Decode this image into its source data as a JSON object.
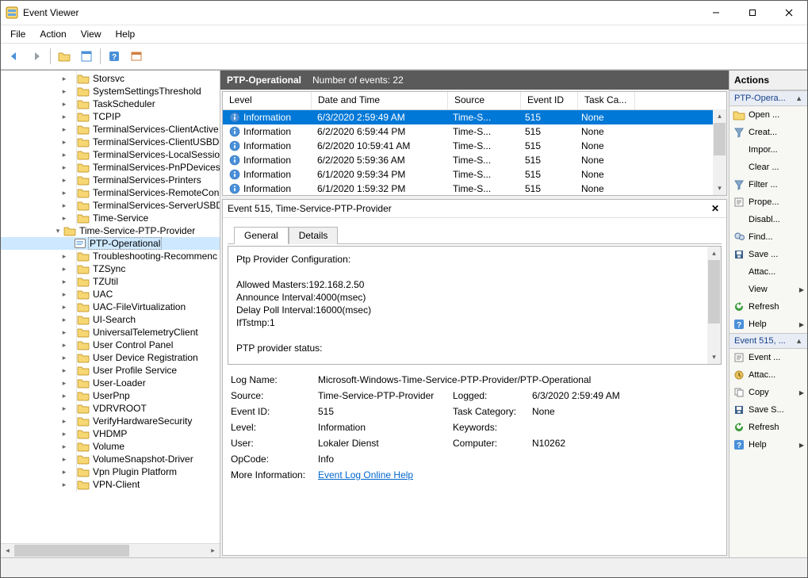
{
  "window": {
    "title": "Event Viewer"
  },
  "menu": {
    "file": "File",
    "action": "Action",
    "view": "View",
    "help": "Help"
  },
  "tree": {
    "items": [
      {
        "indent": 5,
        "tw": "col",
        "icon": "folder",
        "label": "Storsvc"
      },
      {
        "indent": 5,
        "tw": "col",
        "icon": "folder",
        "label": "SystemSettingsThreshold"
      },
      {
        "indent": 5,
        "tw": "col",
        "icon": "folder",
        "label": "TaskScheduler"
      },
      {
        "indent": 5,
        "tw": "col",
        "icon": "folder",
        "label": "TCPIP"
      },
      {
        "indent": 5,
        "tw": "col",
        "icon": "folder",
        "label": "TerminalServices-ClientActive"
      },
      {
        "indent": 5,
        "tw": "col",
        "icon": "folder",
        "label": "TerminalServices-ClientUSBDe"
      },
      {
        "indent": 5,
        "tw": "col",
        "icon": "folder",
        "label": "TerminalServices-LocalSession"
      },
      {
        "indent": 5,
        "tw": "col",
        "icon": "folder",
        "label": "TerminalServices-PnPDevices"
      },
      {
        "indent": 5,
        "tw": "col",
        "icon": "folder",
        "label": "TerminalServices-Printers"
      },
      {
        "indent": 5,
        "tw": "col",
        "icon": "folder",
        "label": "TerminalServices-RemoteCon"
      },
      {
        "indent": 5,
        "tw": "col",
        "icon": "folder",
        "label": "TerminalServices-ServerUSBDe"
      },
      {
        "indent": 5,
        "tw": "col",
        "icon": "folder",
        "label": "Time-Service"
      },
      {
        "indent": 5,
        "tw": "exp",
        "icon": "folder",
        "label": "Time-Service-PTP-Provider"
      },
      {
        "indent": 6,
        "tw": "",
        "icon": "log",
        "label": "PTP-Operational",
        "selected": true
      },
      {
        "indent": 5,
        "tw": "col",
        "icon": "folder",
        "label": "Troubleshooting-Recommenc"
      },
      {
        "indent": 5,
        "tw": "col",
        "icon": "folder",
        "label": "TZSync"
      },
      {
        "indent": 5,
        "tw": "col",
        "icon": "folder",
        "label": "TZUtil"
      },
      {
        "indent": 5,
        "tw": "col",
        "icon": "folder",
        "label": "UAC"
      },
      {
        "indent": 5,
        "tw": "col",
        "icon": "folder",
        "label": "UAC-FileVirtualization"
      },
      {
        "indent": 5,
        "tw": "col",
        "icon": "folder",
        "label": "UI-Search"
      },
      {
        "indent": 5,
        "tw": "col",
        "icon": "folder",
        "label": "UniversalTelemetryClient"
      },
      {
        "indent": 5,
        "tw": "col",
        "icon": "folder",
        "label": "User Control Panel"
      },
      {
        "indent": 5,
        "tw": "col",
        "icon": "folder",
        "label": "User Device Registration"
      },
      {
        "indent": 5,
        "tw": "col",
        "icon": "folder",
        "label": "User Profile Service"
      },
      {
        "indent": 5,
        "tw": "col",
        "icon": "folder",
        "label": "User-Loader"
      },
      {
        "indent": 5,
        "tw": "col",
        "icon": "folder",
        "label": "UserPnp"
      },
      {
        "indent": 5,
        "tw": "col",
        "icon": "folder",
        "label": "VDRVROOT"
      },
      {
        "indent": 5,
        "tw": "col",
        "icon": "folder",
        "label": "VerifyHardwareSecurity"
      },
      {
        "indent": 5,
        "tw": "col",
        "icon": "folder",
        "label": "VHDMP"
      },
      {
        "indent": 5,
        "tw": "col",
        "icon": "folder",
        "label": "Volume"
      },
      {
        "indent": 5,
        "tw": "col",
        "icon": "folder",
        "label": "VolumeSnapshot-Driver"
      },
      {
        "indent": 5,
        "tw": "col",
        "icon": "folder",
        "label": "Vpn Plugin Platform"
      },
      {
        "indent": 5,
        "tw": "col",
        "icon": "folder",
        "label": "VPN-Client"
      }
    ]
  },
  "center": {
    "header_name": "PTP-Operational",
    "header_count": "Number of events: 22",
    "columns": {
      "level": "Level",
      "dt": "Date and Time",
      "src": "Source",
      "eid": "Event ID",
      "cat": "Task Ca..."
    },
    "rows": [
      {
        "level": "Information",
        "dt": "6/3/2020 2:59:49 AM",
        "src": "Time-S...",
        "eid": "515",
        "cat": "None",
        "sel": true
      },
      {
        "level": "Information",
        "dt": "6/2/2020 6:59:44 PM",
        "src": "Time-S...",
        "eid": "515",
        "cat": "None"
      },
      {
        "level": "Information",
        "dt": "6/2/2020 10:59:41 AM",
        "src": "Time-S...",
        "eid": "515",
        "cat": "None"
      },
      {
        "level": "Information",
        "dt": "6/2/2020 5:59:36 AM",
        "src": "Time-S...",
        "eid": "515",
        "cat": "None"
      },
      {
        "level": "Information",
        "dt": "6/1/2020 9:59:34 PM",
        "src": "Time-S...",
        "eid": "515",
        "cat": "None"
      },
      {
        "level": "Information",
        "dt": "6/1/2020 1:59:32 PM",
        "src": "Time-S...",
        "eid": "515",
        "cat": "None"
      }
    ],
    "detail_title": "Event 515, Time-Service-PTP-Provider",
    "tabs": {
      "general": "General",
      "details": "Details"
    },
    "description": "Ptp Provider Configuration:\n\nAllowed Masters:192.168.2.50\nAnnounce Interval:4000(msec)\nDelay Poll Interval:16000(msec)\nIfTstmp:1\n\nPTP provider status:\n\nPTP Best Master Details:\nName:",
    "props": {
      "log_name_l": "Log Name:",
      "log_name_v": "Microsoft-Windows-Time-Service-PTP-Provider/PTP-Operational",
      "source_l": "Source:",
      "source_v": "Time-Service-PTP-Provider",
      "logged_l": "Logged:",
      "logged_v": "6/3/2020 2:59:49 AM",
      "eid_l": "Event ID:",
      "eid_v": "515",
      "cat_l": "Task Category:",
      "cat_v": "None",
      "level_l": "Level:",
      "level_v": "Information",
      "kw_l": "Keywords:",
      "kw_v": "",
      "user_l": "User:",
      "user_v": "Lokaler Dienst",
      "comp_l": "Computer:",
      "comp_v": "N10262",
      "op_l": "OpCode:",
      "op_v": "Info",
      "more_l": "More Information:",
      "more_v": "Event Log Online Help"
    }
  },
  "actions": {
    "title": "Actions",
    "section1": "PTP-Opera...",
    "section2": "Event 515, ...",
    "s1": [
      {
        "ic": "open",
        "label": "Open ..."
      },
      {
        "ic": "filter",
        "label": "Creat..."
      },
      {
        "ic": "",
        "label": "Impor..."
      },
      {
        "ic": "",
        "label": "Clear ..."
      },
      {
        "ic": "filter",
        "label": "Filter ..."
      },
      {
        "ic": "props",
        "label": "Prope..."
      },
      {
        "ic": "",
        "label": "Disabl..."
      },
      {
        "ic": "find",
        "label": "Find..."
      },
      {
        "ic": "save",
        "label": "Save ..."
      },
      {
        "ic": "",
        "label": "Attac..."
      },
      {
        "ic": "",
        "label": "View",
        "arrow": true
      },
      {
        "ic": "refresh",
        "label": "Refresh"
      },
      {
        "ic": "help",
        "label": "Help",
        "arrow": true
      }
    ],
    "s2": [
      {
        "ic": "props",
        "label": "Event ..."
      },
      {
        "ic": "attach",
        "label": "Attac..."
      },
      {
        "ic": "copy",
        "label": "Copy",
        "arrow": true
      },
      {
        "ic": "save",
        "label": "Save S..."
      },
      {
        "ic": "refresh",
        "label": "Refresh"
      },
      {
        "ic": "help",
        "label": "Help",
        "arrow": true
      }
    ]
  }
}
